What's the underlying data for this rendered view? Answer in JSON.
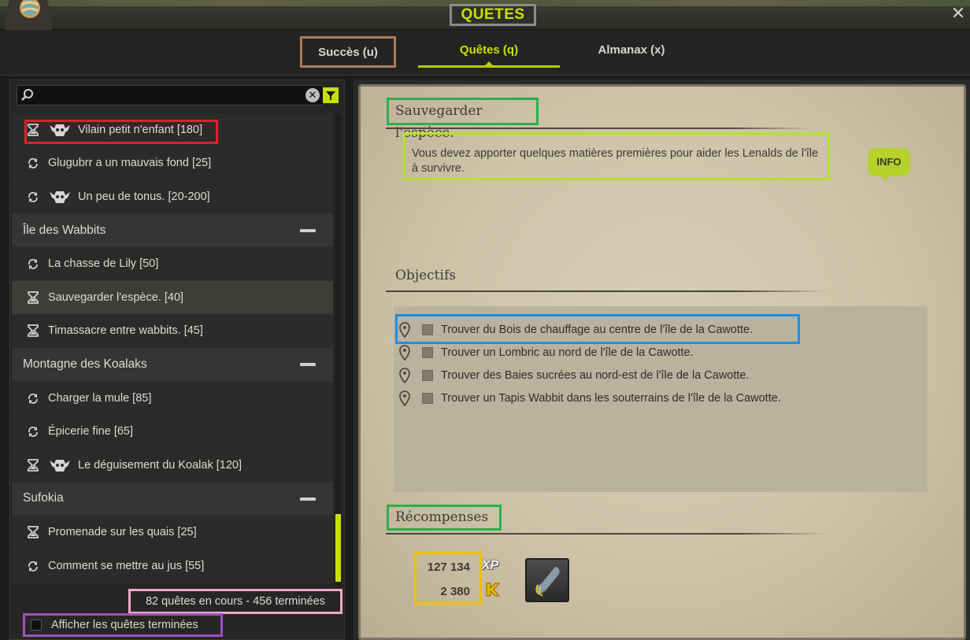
{
  "window": {
    "title": "QUETES",
    "close_symbol": "✕",
    "logo_icon": "dofus-egg-icon"
  },
  "tabs": [
    {
      "label": "Succès (u)",
      "active": false
    },
    {
      "label": "Quêtes (q)",
      "active": true
    },
    {
      "label": "Almanax (x)",
      "active": false
    }
  ],
  "search": {
    "placeholder": "",
    "value": "",
    "search_icon": "search-icon",
    "clear_icon": "clear-icon",
    "filter_icon": "filter-icon"
  },
  "quest_list": {
    "rows": [
      {
        "kind": "quest",
        "status_icon": "hourglass-icon",
        "dungeon": true,
        "label": "Vilain petit n'enfant [180]"
      },
      {
        "kind": "quest",
        "status_icon": "repeat-icon",
        "dungeon": false,
        "label": "Glugubrr a un mauvais fond [25]"
      },
      {
        "kind": "quest",
        "status_icon": "repeat-icon",
        "dungeon": true,
        "label": "Un peu de tonus. [20-200]"
      },
      {
        "kind": "group",
        "label": "Île des Wabbits"
      },
      {
        "kind": "quest",
        "status_icon": "repeat-icon",
        "dungeon": false,
        "label": "La chasse de Lily [50]"
      },
      {
        "kind": "quest",
        "status_icon": "hourglass-icon",
        "dungeon": false,
        "label": "Sauvegarder l'espèce. [40]",
        "selected": true
      },
      {
        "kind": "quest",
        "status_icon": "hourglass-icon",
        "dungeon": false,
        "label": "Timassacre entre wabbits. [45]"
      },
      {
        "kind": "group",
        "label": "Montagne des Koalaks"
      },
      {
        "kind": "quest",
        "status_icon": "repeat-icon",
        "dungeon": false,
        "label": "Charger la mule [85]"
      },
      {
        "kind": "quest",
        "status_icon": "repeat-icon",
        "dungeon": false,
        "label": "Épicerie fine [65]"
      },
      {
        "kind": "quest",
        "status_icon": "hourglass-icon",
        "dungeon": true,
        "label": "Le déguisement du Koalak [120]"
      },
      {
        "kind": "group",
        "label": "Sufokia"
      },
      {
        "kind": "quest",
        "status_icon": "hourglass-icon",
        "dungeon": false,
        "label": "Promenade sur les quais [25]"
      },
      {
        "kind": "quest",
        "status_icon": "repeat-icon",
        "dungeon": false,
        "label": "Comment se mettre au jus [55]"
      }
    ],
    "counter": "82 quêtes en cours - 456 terminées",
    "show_finished_label": "Afficher les quêtes terminées",
    "show_finished_checked": false
  },
  "quest_detail": {
    "title": "Sauvegarder l'espèce.",
    "description": "Vous devez apporter quelques matières premières pour aider les Lenalds de l'île à survivre.",
    "info_label": "INFO",
    "objectives_heading": "Objectifs",
    "objectives": [
      {
        "label": "Trouver du Bois de chauffage au centre de l'île de la Cawotte."
      },
      {
        "label": "Trouver un Lombric au nord de l'île de la Cawotte."
      },
      {
        "label": "Trouver des Baies sucrées au nord-est de l'île de la Cawotte."
      },
      {
        "label": "Trouver un Tapis Wabbit dans les souterrains de l'île de la Cawotte."
      }
    ],
    "rewards_heading": "Récompenses",
    "rewards": {
      "xp_value": "127 134",
      "xp_label": "XP",
      "kamas_value": "2 380",
      "kamas_icon": "kamas-icon",
      "item_icon": "item-reward-icon"
    }
  },
  "colors": {
    "accent": "#c9e000",
    "parchment": "#d2c8ae"
  }
}
